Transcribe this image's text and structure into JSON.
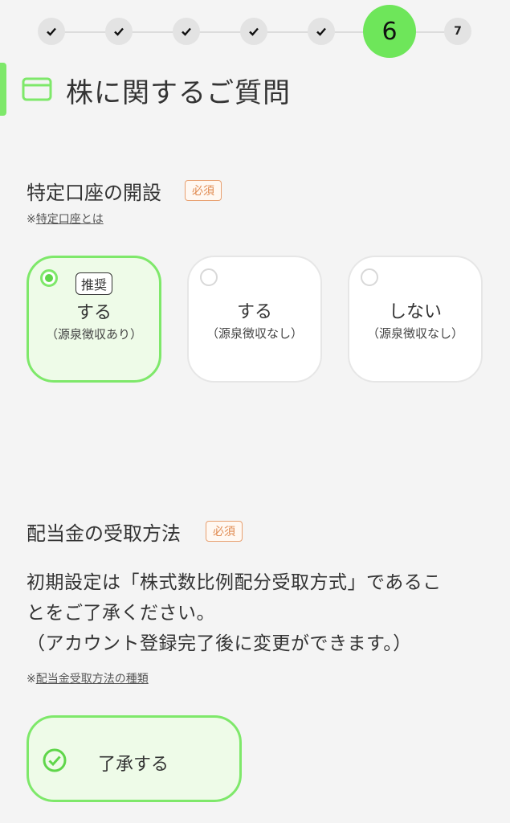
{
  "stepper": {
    "steps": [
      "✓",
      "✓",
      "✓",
      "✓",
      "✓",
      "6",
      "7"
    ],
    "current": "6"
  },
  "section": {
    "title": "株に関するご質問",
    "icon": "card-icon"
  },
  "account": {
    "label": "特定口座の開設",
    "required": "必須",
    "note_prefix": "※",
    "note_link": "特定口座とは",
    "options": [
      {
        "recommend": "推奨",
        "main": "する",
        "sub": "（源泉徴収あり）",
        "selected": true
      },
      {
        "main": "する",
        "sub": "（源泉徴収なし）",
        "selected": false
      },
      {
        "main": "しない",
        "sub": "（源泉徴収なし）",
        "selected": false
      }
    ]
  },
  "dividend": {
    "label": "配当金の受取方法",
    "required": "必須",
    "body_line1": "初期設定は「株式数比例配分受取方式」であるこ",
    "body_line2": "とをご了承ください。",
    "body_line3": "（アカウント登録完了後に変更ができます。）",
    "note_prefix": "※",
    "note_link": "配当金受取方法の種類",
    "agree_label": "了承する",
    "agreed": true
  },
  "colors": {
    "accent": "#7ee86a",
    "required": "#e08a50",
    "background": "#f4f4f4"
  }
}
